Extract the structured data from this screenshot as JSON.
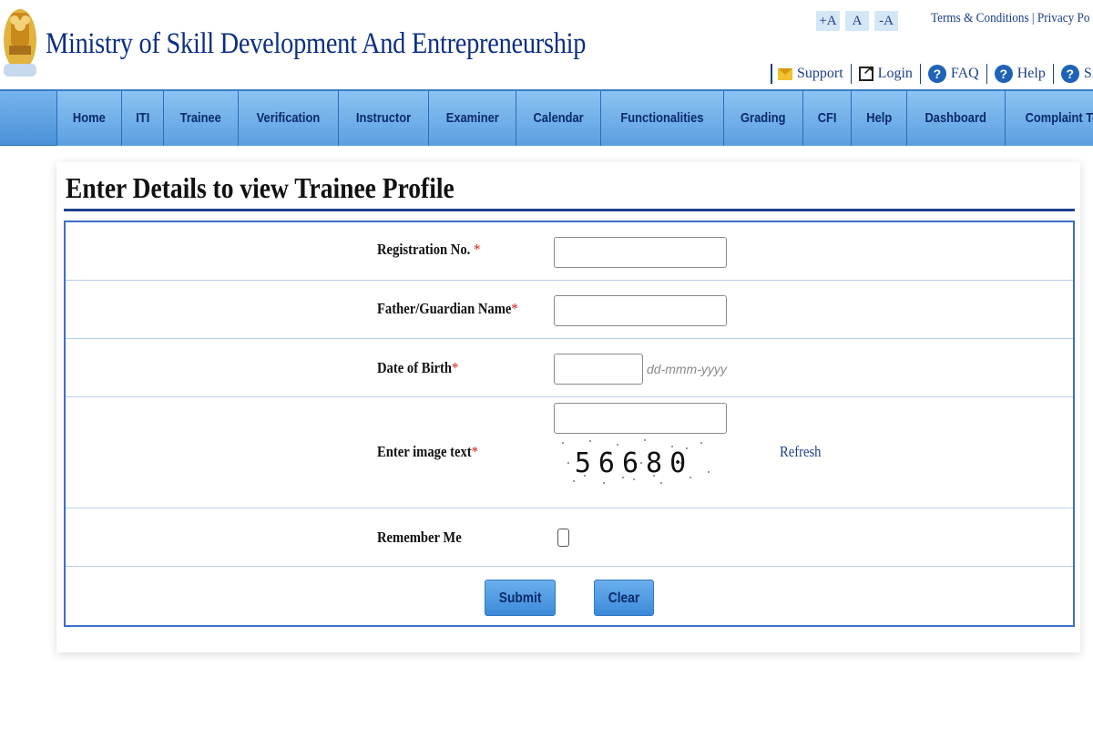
{
  "header": {
    "title": "Ministry of Skill Development And Entrepreneurship",
    "font_sizes": [
      "+A",
      "A",
      "-A"
    ],
    "top_links": "Terms & Conditions | Privacy Po",
    "utility_links": [
      {
        "label": "Support",
        "icon": "mail-icon"
      },
      {
        "label": "Login",
        "icon": "external-login-icon"
      },
      {
        "label": "FAQ",
        "icon": "help-icon"
      },
      {
        "label": "Help",
        "icon": "help-icon"
      },
      {
        "label": "Site",
        "icon": "help-icon"
      }
    ]
  },
  "nav": {
    "items": [
      "Home",
      "ITI",
      "Trainee",
      "Verification",
      "Instructor",
      "Examiner",
      "Calendar",
      "Functionalities",
      "Grading",
      "CFI",
      "Help",
      "Dashboard",
      "Complaint Tool"
    ]
  },
  "main": {
    "title": "Enter Details to view Trainee Profile",
    "fields": {
      "registration_label": "Registration No.",
      "father_label": "Father/Guardian Name",
      "dob_label": "Date of Birth",
      "dob_hint": "dd-mmm-yyyy",
      "captcha_label": "Enter image text",
      "captcha_text": "56680",
      "refresh_label": "Refresh",
      "remember_label": "Remember Me",
      "required_marker": "*"
    },
    "buttons": {
      "submit": "Submit",
      "clear": "Clear"
    }
  },
  "colors": {
    "title_blue": "#0a2e84",
    "nav_blue": "#5b9fe0",
    "required_red": "#d21f1f"
  }
}
